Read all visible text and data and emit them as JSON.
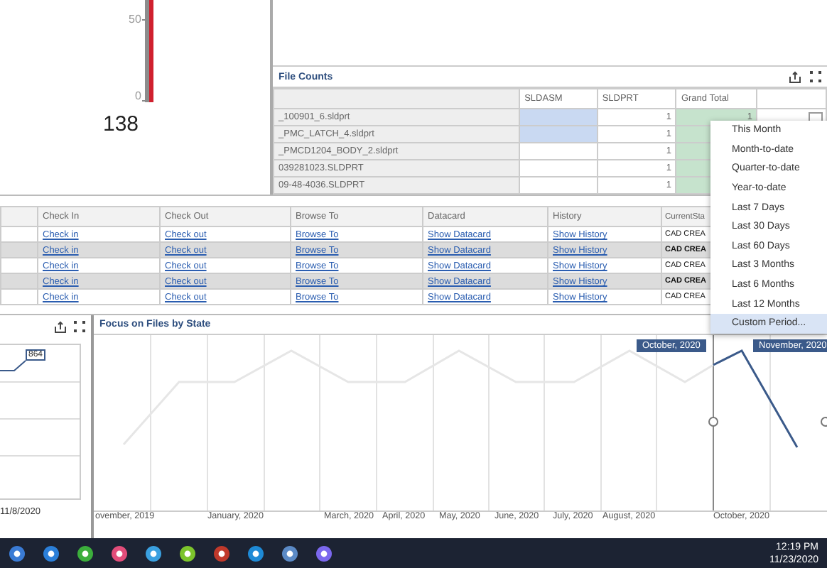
{
  "gauge": {
    "ticks": [
      "50",
      "0"
    ],
    "value": "138"
  },
  "file_counts": {
    "title": "File Counts",
    "columns": [
      "SLDASM",
      "SLDPRT",
      "Grand Total"
    ],
    "rows": [
      {
        "name": "_100901_6.sldprt",
        "sldasm_highlighted": true,
        "sldprt": "1",
        "grand_total": "1"
      },
      {
        "name": "_PMC_LATCH_4.sldprt",
        "sldasm_highlighted": true,
        "sldprt": "1"
      },
      {
        "name": "_PMCD1204_BODY_2.sldprt",
        "sldasm_highlighted": false,
        "sldprt": "1"
      },
      {
        "name": "039281023.SLDPRT",
        "sldasm_highlighted": false,
        "sldprt": "1"
      },
      {
        "name": "09-48-4036.SLDPRT",
        "sldasm_highlighted": false,
        "sldprt": "1"
      }
    ]
  },
  "period_menu": {
    "items": [
      {
        "label": "This Month",
        "selected": false
      },
      {
        "label": "Month-to-date",
        "selected": false
      },
      {
        "label": "Quarter-to-date",
        "selected": false
      },
      {
        "label": "Year-to-date",
        "selected": false
      },
      {
        "label": "Last 7 Days",
        "selected": false
      },
      {
        "label": "Last 30 Days",
        "selected": false
      },
      {
        "label": "Last 60 Days",
        "selected": false
      },
      {
        "label": "Last 3 Months",
        "selected": false
      },
      {
        "label": "Last 6 Months",
        "selected": false
      },
      {
        "label": "Last 12 Months",
        "selected": false
      },
      {
        "label": "Custom Period...",
        "selected": true
      }
    ]
  },
  "actions_table": {
    "columns": [
      "Check In",
      "Check Out",
      "Browse To",
      "Datacard",
      "History",
      "CurrentSta"
    ],
    "rows": [
      {
        "links": [
          "Check in",
          "Check out",
          "Browse To",
          "Show Datacard",
          "Show History"
        ],
        "state": "CAD CREA"
      },
      {
        "links": [
          "Check in",
          "Check out",
          "Browse To",
          "Show Datacard",
          "Show History"
        ],
        "state": "CAD CREA"
      },
      {
        "links": [
          "Check in",
          "Check out",
          "Browse To",
          "Show Datacard",
          "Show History"
        ],
        "state": "CAD CREA"
      },
      {
        "links": [
          "Check in",
          "Check out",
          "Browse To",
          "Show Datacard",
          "Show History"
        ],
        "state": "CAD CREA"
      },
      {
        "links": [
          "Check in",
          "Check out",
          "Browse To",
          "Show Datacard",
          "Show History"
        ],
        "state": "CAD CREA"
      }
    ]
  },
  "mini_chart": {
    "point_label": "864",
    "date_label": "11/8/2020"
  },
  "focus_chart": {
    "title": "Focus on Files by State",
    "x_labels": [
      "ovember, 2019",
      "January, 2020",
      "March, 2020",
      "April, 2020",
      "May, 2020",
      "June, 2020",
      "July, 2020",
      "August, 2020",
      "October, 2020"
    ],
    "tooltips": [
      "October, 2020",
      "November, 2020"
    ]
  },
  "taskbar": {
    "time": "12:19 PM",
    "date": "11/23/2020"
  }
}
